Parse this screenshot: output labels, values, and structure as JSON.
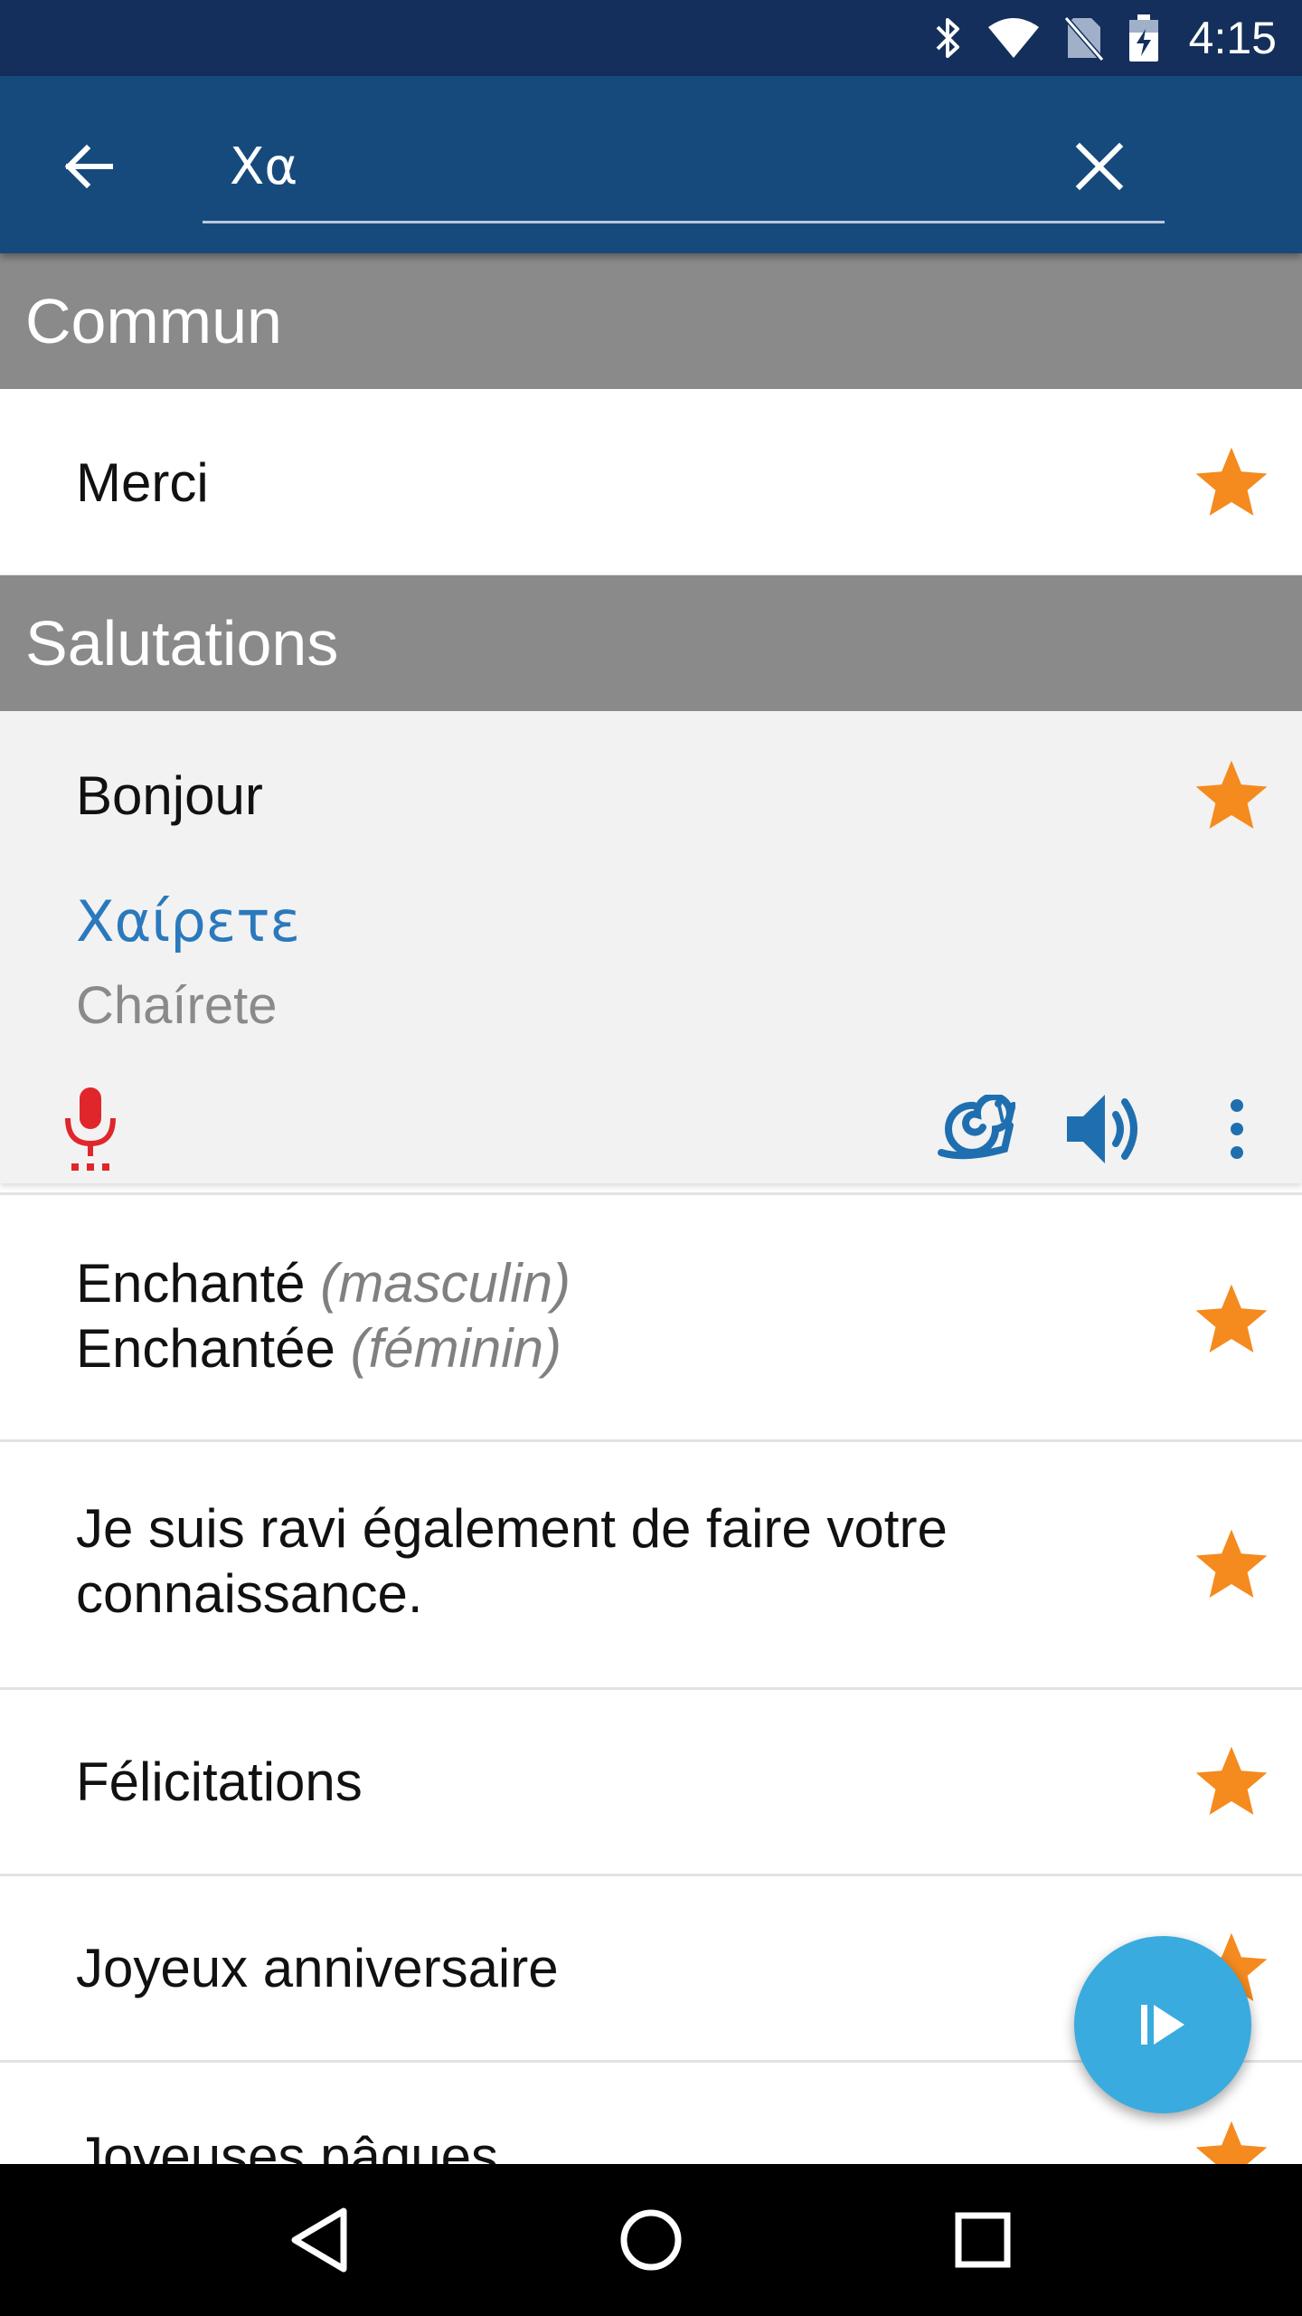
{
  "status_bar": {
    "time": "4:15",
    "icons": [
      "bluetooth-icon",
      "wifi-icon",
      "no-sim-icon",
      "battery-charging-icon"
    ]
  },
  "app_bar": {
    "back_icon": "arrow-left-icon",
    "search_value": "Χα",
    "clear_icon": "close-icon"
  },
  "colors": {
    "status_bar": "#142f5c",
    "app_bar": "#174a7c",
    "section_header": "#8a8a8a",
    "star": "#f58a1f",
    "greek_text": "#2a79bd",
    "mic": "#e0262b",
    "audio_icons": "#1f6fb0",
    "fab": "#3aabdf"
  },
  "sections": [
    {
      "title": "Commun",
      "items": [
        {
          "text": "Merci",
          "favorite": true
        }
      ]
    },
    {
      "title": "Salutations",
      "items": [
        {
          "text": "Bonjour",
          "favorite": true,
          "expanded": true,
          "translation": "Χαίρετε",
          "transliteration": "Chaírete",
          "actions": [
            "microphone-icon",
            "snail-slow-icon",
            "speaker-icon",
            "more-vert-icon"
          ]
        },
        {
          "line1": "Enchanté",
          "line1_note": "(masculin)",
          "line2": "Enchantée",
          "line2_note": "(féminin)",
          "favorite": true
        },
        {
          "line1": "Je suis ravi également de faire votre",
          "line2": "connaissance.",
          "favorite": true
        },
        {
          "text": "Félicitations",
          "favorite": true
        },
        {
          "text": "Joyeux anniversaire",
          "favorite": true
        },
        {
          "text": "Joyeuses pâques",
          "favorite": true
        }
      ]
    }
  ],
  "fab": {
    "icon": "play-next-icon"
  },
  "nav_bar": {
    "icons": [
      "nav-back-icon",
      "nav-home-icon",
      "nav-recents-icon"
    ]
  }
}
